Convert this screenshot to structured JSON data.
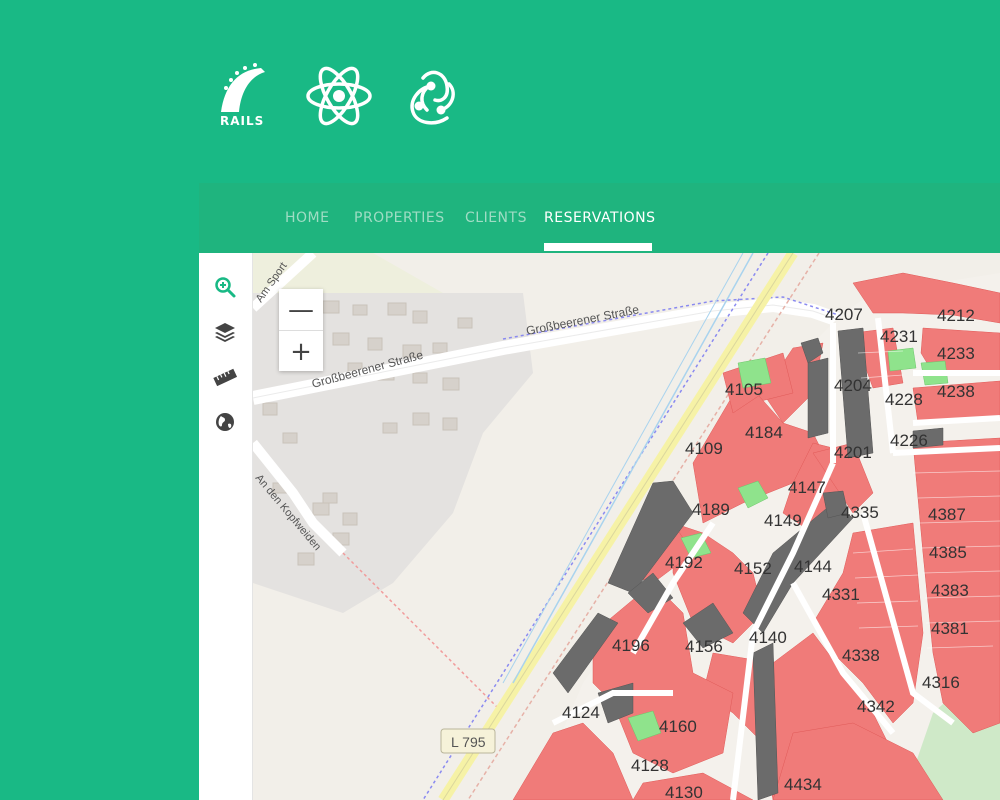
{
  "colors": {
    "background": "#19b985",
    "navbar": "#1fb47e",
    "nav_inactive": "#9fdcc4",
    "nav_active": "#ffffff",
    "accent": "#19b985",
    "plot_sold": "#f07b79",
    "plot_reserved": "#6b6b6b",
    "plot_available": "#8fe38c",
    "map_base": "#f2efe9"
  },
  "logos": [
    {
      "name": "rails-logo",
      "text": "RAILS"
    },
    {
      "name": "react-logo"
    },
    {
      "name": "redux-logo"
    }
  ],
  "nav": {
    "items": [
      {
        "label": "HOME"
      },
      {
        "label": "PROPERTIES"
      },
      {
        "label": "CLIENTS"
      },
      {
        "label": "RESERVATIONS",
        "active": true
      }
    ]
  },
  "sidebar": {
    "icons": [
      "zoom-search-icon",
      "layers-icon",
      "ruler-icon",
      "globe-icon"
    ]
  },
  "map": {
    "zoom_out_label": "—",
    "zoom_in_label": "+",
    "street_labels": [
      "Großbeerener Straße",
      "Großbeerener Straße",
      "An den Kopfweiden",
      "Am Sport"
    ],
    "road_badge": "L 795",
    "plot_labels": [
      "4207",
      "4212",
      "4231",
      "4233",
      "4204",
      "4228",
      "4238",
      "4105",
      "4184",
      "4201",
      "4226",
      "4109",
      "4147",
      "4189",
      "4149",
      "4335",
      "4387",
      "4192",
      "4152",
      "4144",
      "4385",
      "4331",
      "4383",
      "4196",
      "4156",
      "4140",
      "4381",
      "4338",
      "4316",
      "4124",
      "4160",
      "4342",
      "4128",
      "4130",
      "4434"
    ]
  }
}
